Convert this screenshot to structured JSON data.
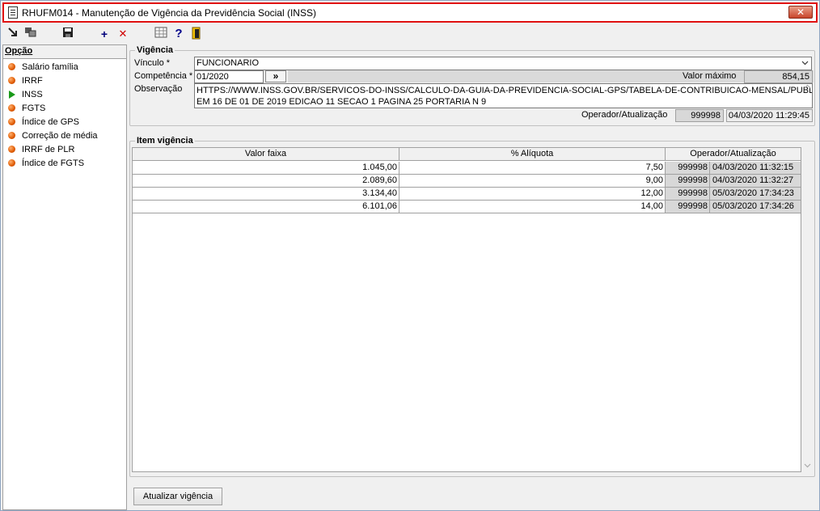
{
  "window": {
    "title": "RHUFM014 - Manutenção de Vigência da Previdência Social (INSS)",
    "close_label": "✕"
  },
  "toolbar": {
    "icons": [
      "export-icon",
      "copy-icon",
      "save-icon",
      "add-icon",
      "delete-icon",
      "calculator-icon",
      "help-icon",
      "exit-icon"
    ],
    "add_glyph": "+",
    "delete_glyph": "✕",
    "help_glyph": "?"
  },
  "sidebar": {
    "header": "Opção",
    "items": [
      {
        "label": "Salário família",
        "selected": false
      },
      {
        "label": "IRRF",
        "selected": false
      },
      {
        "label": "INSS",
        "selected": true
      },
      {
        "label": "FGTS",
        "selected": false
      },
      {
        "label": "Índice de GPS",
        "selected": false
      },
      {
        "label": "Correção de média",
        "selected": false
      },
      {
        "label": "IRRF de PLR",
        "selected": false
      },
      {
        "label": "Índice de FGTS",
        "selected": false
      }
    ]
  },
  "vigencia": {
    "group_title": "Vigência",
    "vinculo_label": "Vínculo *",
    "vinculo_value": "FUNCIONARIO",
    "competencia_label": "Competência *",
    "competencia_value": "01/2020",
    "next_button": "»",
    "valor_maximo_label": "Valor máximo",
    "valor_maximo_value": "854,15",
    "observacao_label": "Observação",
    "observacao_line1": "HTTPS://WWW.INSS.GOV.BR/SERVICOS-DO-INSS/CALCULO-DA-GUIA-DA-PREVIDENCIA-SOCIAL-GPS/TABELA-DE-CONTRIBUICAO-MENSAL/PUBLICADO",
    "observacao_line2": "EM 16 DE 01 DE 2019  EDICAO  11  SECAO 1 PAGINA 25 PORTARIA  N 9",
    "operador_label": "Operador/Atualização",
    "operador_code": "999998",
    "operador_date": "04/03/2020 11:29:45"
  },
  "itens": {
    "group_title": "Item vigência",
    "columns": [
      "Valor faixa",
      "% Alíquota",
      "Operador/Atualização"
    ],
    "rows": [
      {
        "valor": "1.045,00",
        "aliquota": "7,50",
        "operador": "999998",
        "data": "04/03/2020 11:32:15"
      },
      {
        "valor": "2.089,60",
        "aliquota": "9,00",
        "operador": "999998",
        "data": "04/03/2020 11:32:27"
      },
      {
        "valor": "3.134,40",
        "aliquota": "12,00",
        "operador": "999998",
        "data": "05/03/2020 17:34:23"
      },
      {
        "valor": "6.101,06",
        "aliquota": "14,00",
        "operador": "999998",
        "data": "05/03/2020 17:34:26"
      }
    ]
  },
  "footer": {
    "update_button": "Atualizar vigência"
  }
}
